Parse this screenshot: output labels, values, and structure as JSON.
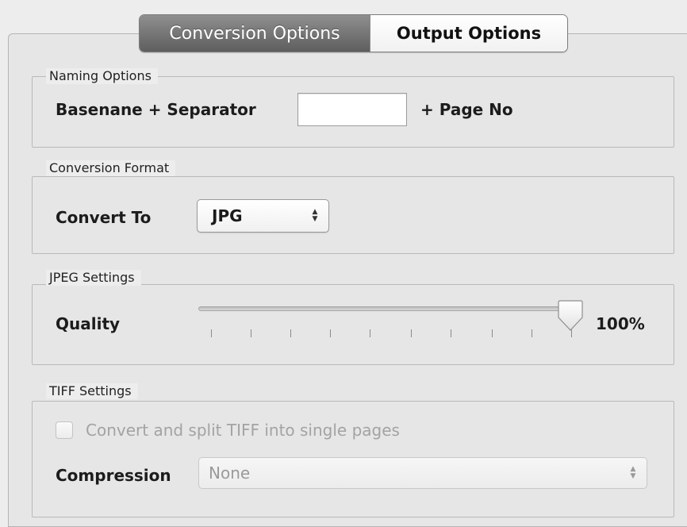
{
  "tabs": {
    "active": "Conversion Options",
    "inactive": "Output Options"
  },
  "naming": {
    "title": "Naming Options",
    "prefix_label": "Basenane + Separator",
    "separator_value": "",
    "suffix_label": "+ Page No"
  },
  "format": {
    "title": "Conversion Format",
    "label": "Convert To",
    "selected": "JPG"
  },
  "jpeg": {
    "title": "JPEG Settings",
    "label": "Quality",
    "quality_value": 100,
    "quality_text": "100%"
  },
  "tiff": {
    "title": "TIFF Settings",
    "split_label": "Convert and split TIFF into single pages",
    "split_checked": false,
    "compression_label": "Compression",
    "compression_selected": "None"
  }
}
